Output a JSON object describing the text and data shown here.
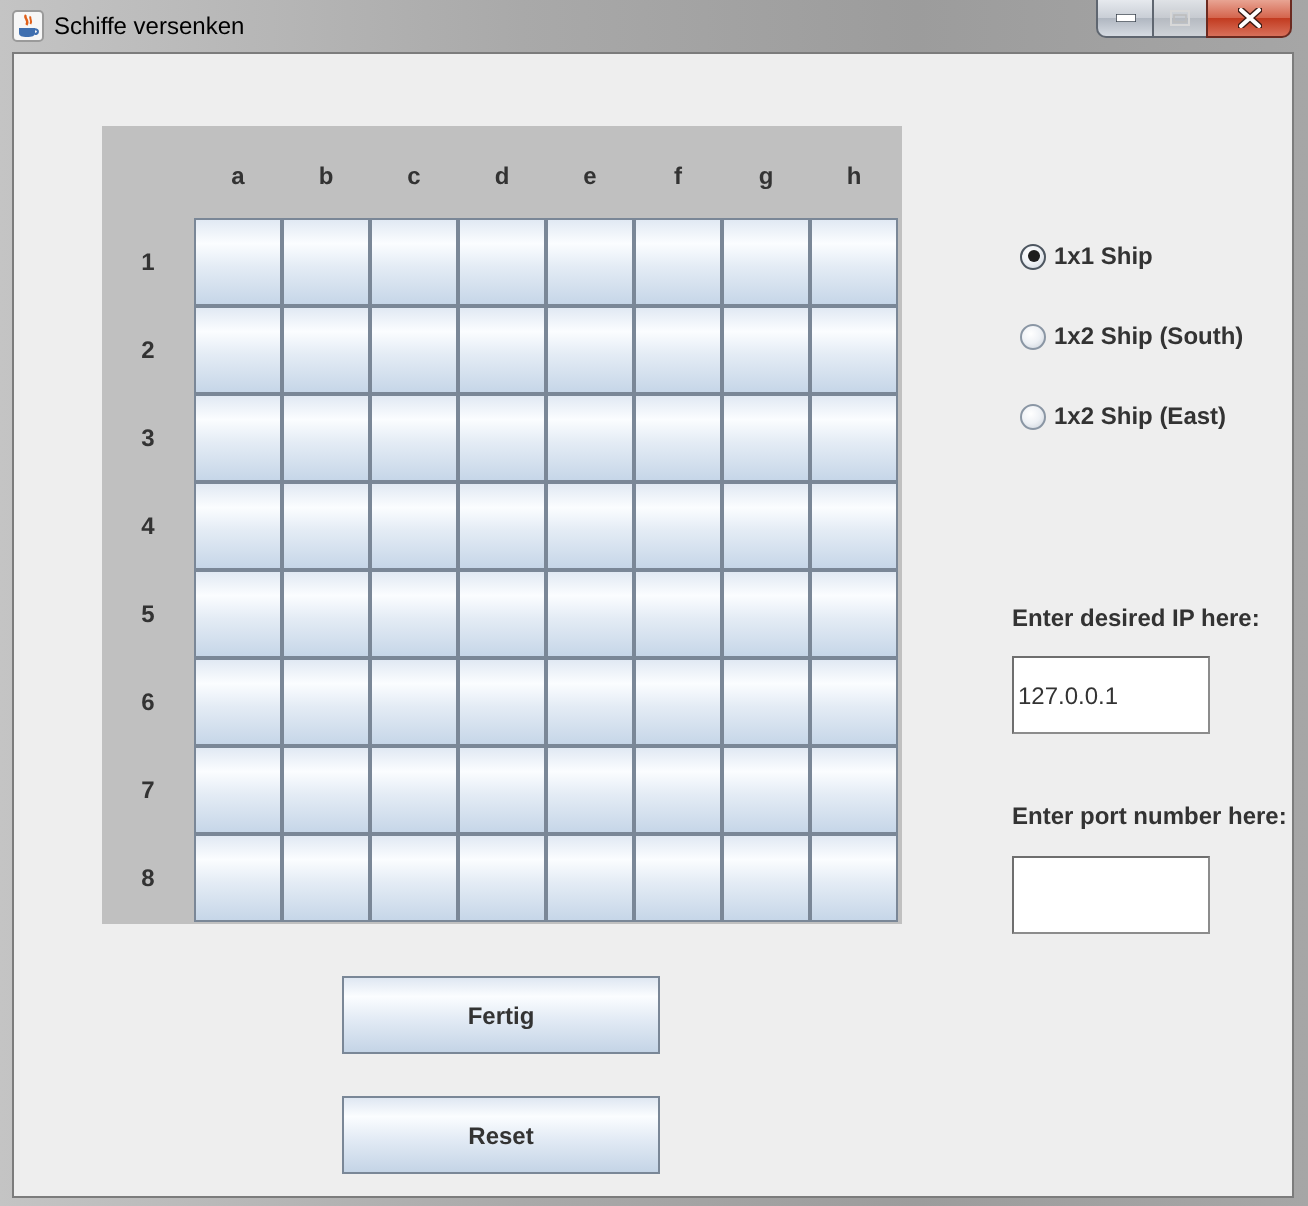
{
  "window": {
    "title": "Schiffe versenken"
  },
  "board": {
    "columns": [
      "a",
      "b",
      "c",
      "d",
      "e",
      "f",
      "g",
      "h"
    ],
    "rows": [
      "1",
      "2",
      "3",
      "4",
      "5",
      "6",
      "7",
      "8"
    ]
  },
  "ship_types": [
    {
      "label": "1x1 Ship",
      "selected": true
    },
    {
      "label": "1x2 Ship (South)",
      "selected": false
    },
    {
      "label": "1x2 Ship (East)",
      "selected": false
    }
  ],
  "ip": {
    "label": "Enter desired IP here:",
    "value": "127.0.0.1"
  },
  "port": {
    "label": "Enter port number here:"
  },
  "buttons": [
    "Fertig",
    "Reset"
  ]
}
